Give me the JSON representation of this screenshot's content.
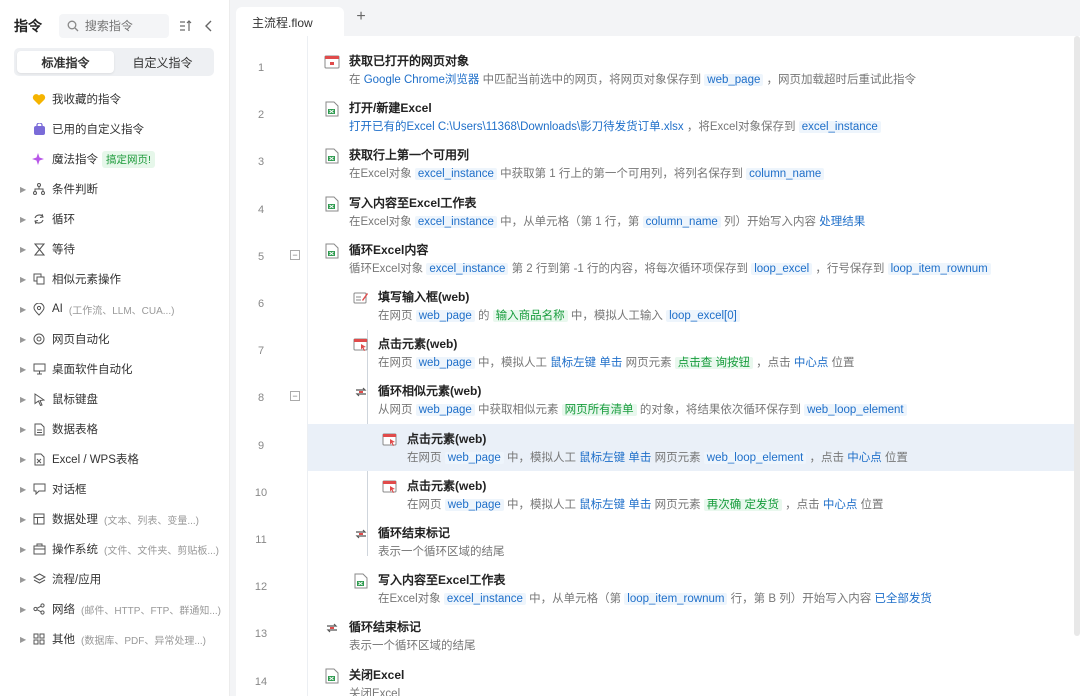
{
  "sidebar": {
    "title": "指令",
    "search_placeholder": "搜索指令",
    "tabs": [
      "标准指令",
      "自定义指令"
    ],
    "items": [
      {
        "label": "我收藏的指令",
        "sub": "",
        "icon": "heart-icon"
      },
      {
        "label": "已用的自定义指令",
        "sub": "",
        "icon": "bag-icon"
      },
      {
        "label": "魔法指令",
        "sub": "",
        "badge": "搞定网页!",
        "icon": "sparkle-icon"
      },
      {
        "label": "条件判断",
        "sub": "",
        "icon": "branch-icon"
      },
      {
        "label": "循环",
        "sub": "",
        "icon": "loop-icon"
      },
      {
        "label": "等待",
        "sub": "",
        "icon": "hourglass-icon"
      },
      {
        "label": "相似元素操作",
        "sub": "",
        "icon": "copy-icon"
      },
      {
        "label": "AI",
        "sub": "(工作流、LLM、CUA...)",
        "icon": "ai-icon"
      },
      {
        "label": "网页自动化",
        "sub": "",
        "icon": "browser-icon"
      },
      {
        "label": "桌面软件自动化",
        "sub": "",
        "icon": "monitor-icon"
      },
      {
        "label": "鼠标键盘",
        "sub": "",
        "icon": "cursor-icon"
      },
      {
        "label": "数据表格",
        "sub": "",
        "icon": "table-icon"
      },
      {
        "label": "Excel / WPS表格",
        "sub": "",
        "icon": "excel-icon"
      },
      {
        "label": "对话框",
        "sub": "",
        "icon": "dialog-icon"
      },
      {
        "label": "数据处理",
        "sub": "(文本、列表、变量...)",
        "icon": "data-icon"
      },
      {
        "label": "操作系统",
        "sub": "(文件、文件夹、剪贴板...)",
        "icon": "os-icon"
      },
      {
        "label": "流程/应用",
        "sub": "",
        "icon": "layers-icon"
      },
      {
        "label": "网络",
        "sub": "(邮件、HTTP、FTP、群通知...)",
        "icon": "network-icon"
      },
      {
        "label": "其他",
        "sub": "(数据库、PDF、异常处理...)",
        "icon": "grid-icon"
      }
    ]
  },
  "tab": {
    "label": "主流程.flow",
    "add": "+"
  },
  "steps": [
    {
      "n": "1",
      "title": "获取已打开的网页对象",
      "desc": "在 <b>Google Chrome浏览器</b> 中匹配当前选中的网页，将网页对象保存到 <v>web_page</v> ，网页加载超时后重试此指令",
      "icon": "browser-red-icon"
    },
    {
      "n": "2",
      "title": "打开/新建Excel",
      "desc": "<b>打开已有的Excel</b> <b>C:\\Users\\11368\\Downloads\\影刀待发货订单.xlsx</b> ，将Excel对象保存到 <v>excel_instance</v>",
      "icon": "excel-open-icon"
    },
    {
      "n": "3",
      "title": "获取行上第一个可用列",
      "desc": "在Excel对象 <v>excel_instance</v> 中获取第 1 行上的第一个可用列，将列名保存到 <v>column_name</v>",
      "icon": "excel-grid-icon"
    },
    {
      "n": "4",
      "title": "写入内容至Excel工作表",
      "desc": "在Excel对象 <v>excel_instance</v> 中，从单元格（第 1 行，第 <v>column_name</v> 列）开始写入内容 <b>处理结果</b>",
      "icon": "excel-write-icon"
    },
    {
      "n": "5",
      "title": "循环Excel内容",
      "desc": "循环Excel对象 <v>excel_instance</v> 第 2 行到第 -1 行的内容，将每次循环项保存到 <v>loop_excel</v> ，行号保存到 <v>loop_item_rownum</v>",
      "icon": "excel-loop-icon"
    },
    {
      "n": "6",
      "title": "填写输入框(web)",
      "desc": "在网页 <v>web_page</v> 的 <g>输入商品名称</g> 中，模拟人工输入 <v>loop_excel[0]</v>",
      "icon": "input-icon"
    },
    {
      "n": "7",
      "title": "点击元素(web)",
      "desc": "在网页 <v>web_page</v> 中，模拟人工 <b>鼠标左键</b> <b>单击</b> 网页元素 <g>点击查 询按钮</g> ，点击 <b>中心点</b> 位置",
      "icon": "click-icon"
    },
    {
      "n": "8",
      "title": "循环相似元素(web)",
      "desc": "从网页 <v>web_page</v> 中获取相似元素 <g>网页所有清单</g> 的对象，将结果依次循环保存到 <v>web_loop_element</v>",
      "icon": "loop-red-icon"
    },
    {
      "n": "9",
      "title": "点击元素(web)",
      "desc": "在网页 <v>web_page</v> 中，模拟人工 <b>鼠标左键</b> <b>单击</b> 网页元素 <v>web_loop_element</v> ，点击 <b>中心点</b> 位置",
      "icon": "click-icon"
    },
    {
      "n": "10",
      "title": "点击元素(web)",
      "desc": "在网页 <v>web_page</v> 中，模拟人工 <b>鼠标左键</b> <b>单击</b> 网页元素 <g>再次确 定发货</g> ，点击 <b>中心点</b> 位置",
      "icon": "click-icon"
    },
    {
      "n": "11",
      "title": "循环结束标记",
      "desc": "表示一个循环区域的结尾",
      "icon": "loop-end-icon"
    },
    {
      "n": "12",
      "title": "写入内容至Excel工作表",
      "desc": "在Excel对象 <v>excel_instance</v> 中，从单元格（第 <v>loop_item_rownum</v> 行，第 B 列）开始写入内容 <b>已全部发货</b>",
      "icon": "excel-write-icon"
    },
    {
      "n": "13",
      "title": "循环结束标记",
      "desc": "表示一个循环区域的结尾",
      "icon": "loop-end-icon"
    },
    {
      "n": "14",
      "title": "关闭Excel",
      "desc": "关闭Excel",
      "icon": "excel-close-icon"
    }
  ]
}
